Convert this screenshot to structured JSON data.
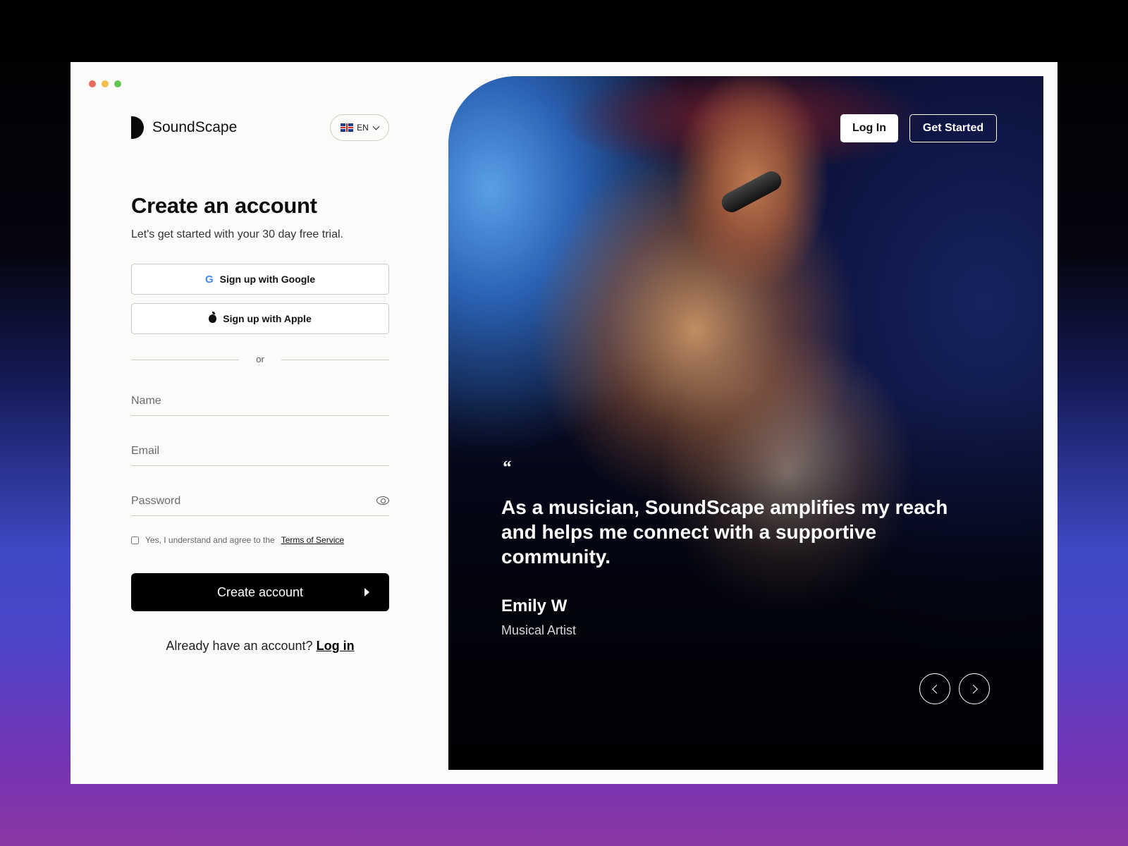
{
  "brand": {
    "name": "SoundScape"
  },
  "language": {
    "code": "EN",
    "flag_icon": "uk-flag-icon"
  },
  "signup": {
    "title": "Create an account",
    "subtitle": "Let's get started with your 30 day free trial.",
    "google_label": "Sign up with Google",
    "apple_label": "Sign up with Apple",
    "divider_text": "or",
    "name_placeholder": "Name",
    "email_placeholder": "Email",
    "password_placeholder": "Password",
    "terms_text": "Yes, I understand and agree to the",
    "terms_link": "Terms of Service",
    "submit_label": "Create account",
    "already_text": "Already have an account?",
    "login_link": "Log in"
  },
  "hero": {
    "login_label": "Log In",
    "get_started_label": "Get Started",
    "quote_mark": "“",
    "quote": "As a musician, SoundScape amplifies my reach and helps me connect with a supportive community.",
    "author": "Emily W",
    "role": "Musical Artist"
  },
  "colors": {
    "primary": "#000000",
    "background": "#fcfbf9"
  }
}
